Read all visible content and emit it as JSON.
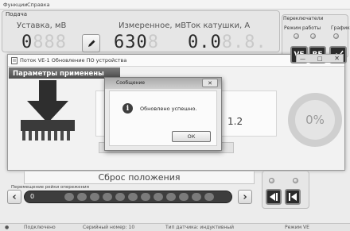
{
  "menu": {
    "functions": "Функции",
    "help": "Справка"
  },
  "sections": {
    "supply": "Подача",
    "switches": "Переключатели"
  },
  "readouts": [
    {
      "label": "Уставка, мВ",
      "lit": "0",
      "dim": "888"
    },
    {
      "label": "Измеренное, мВ",
      "lit": "630",
      "dim": "8"
    },
    {
      "label": "Ток катушки, А",
      "lit": "0.0",
      "dim": "8.8."
    }
  ],
  "switches": {
    "mode_label": "Режим работы",
    "graph_label": "График",
    "btn_ve": "VE",
    "btn_re": "RE"
  },
  "window": {
    "title": "Поток VE-1 Обновление ПО устройства",
    "banner": "Параметры применены",
    "version_fragment": "1.2",
    "progress_percent": "0%"
  },
  "dialog": {
    "title": "Сообщение",
    "message": "Обновлено успешно.",
    "ok": "ОК"
  },
  "reset_label": "Сброс положения",
  "rail": {
    "label": "Перемещение рейки опережения",
    "value": "0"
  },
  "status": {
    "connection": "Подключено",
    "serial": "Серийный номер: 10",
    "sensor_type": "Тип датчика: индуктивный",
    "mode": "Режим VE"
  }
}
